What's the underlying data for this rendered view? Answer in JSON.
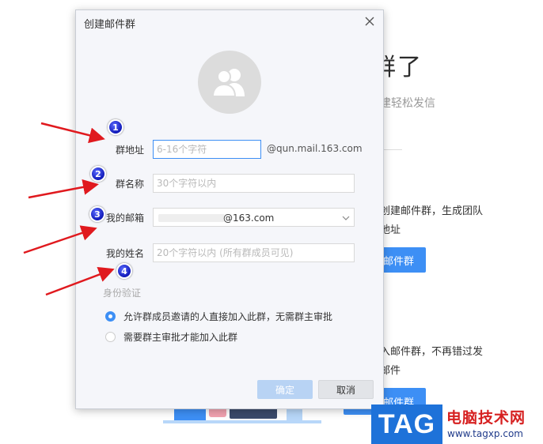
{
  "background": {
    "heading": "群了",
    "subtitle": "建轻松发信",
    "paragraph1_line1": "创建邮件群，生成团队",
    "paragraph1_line2": "地址",
    "button1_label": "邮件群",
    "paragraph2_line1": "入邮件群，不再错过发",
    "paragraph2_line2": "邮件",
    "button2_label": "邮件群"
  },
  "dialog": {
    "title": "创建邮件群",
    "avatar_icon": "group-avatar-icon",
    "group_address": {
      "label": "群地址",
      "placeholder": "6-16个字符",
      "suffix": "@qun.mail.163.com"
    },
    "group_name": {
      "label": "群名称",
      "placeholder": "30个字符以内"
    },
    "my_email": {
      "label": "我的邮箱",
      "value": "@163.com"
    },
    "my_name": {
      "label": "我的姓名",
      "placeholder": "20个字符以内 (所有群成员可见)"
    },
    "verification": {
      "label": "身份验证",
      "options": [
        {
          "label": "允许群成员邀请的人直接加入此群，无需群主审批",
          "checked": true
        },
        {
          "label": "需要群主审批才能加入此群",
          "checked": false
        }
      ]
    },
    "confirm_label": "确定",
    "cancel_label": "取消"
  },
  "annotations": {
    "badges": [
      "1",
      "2",
      "3",
      "4"
    ],
    "arrow_color": "#e0191e",
    "badge_color": "#1019b8"
  },
  "watermark": {
    "tag": "TAG",
    "site_name": "电脑技术网",
    "url": "www.tagxp.com"
  }
}
